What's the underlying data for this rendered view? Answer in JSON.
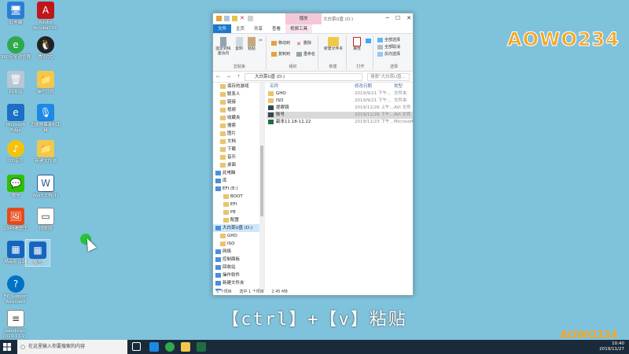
{
  "desktop": {
    "icons": [
      {
        "label": "此电脑"
      },
      {
        "label": "Adobe Acrobat DC"
      },
      {
        "label": "360安全浏览器"
      },
      {
        "label": "腾讯QQ"
      },
      {
        "label": "回收站"
      },
      {
        "label": "操作软件"
      },
      {
        "label": "Microsoft Edge"
      },
      {
        "label": "迅捷屏幕录制工具"
      },
      {
        "label": "QQ音乐"
      },
      {
        "label": "新建文件夹"
      },
      {
        "label": "微信"
      },
      {
        "label": "Word文档(1)"
      },
      {
        "label": "2345看图王"
      },
      {
        "label": "提眼镜"
      },
      {
        "label": "精品影音16"
      },
      {
        "label": "账号"
      },
      {
        "label": "HP Support Assistant"
      },
      {
        "label": "bandicam 2019-11-2..."
      }
    ]
  },
  "logo": {
    "text": "AOWO234"
  },
  "window": {
    "title": "大白菜U盘 (D:)",
    "manage_tab": "播放",
    "tabs": [
      "文件",
      "主页",
      "共享",
      "查看",
      "视频工具"
    ],
    "ribbon": {
      "clipboard": {
        "group": "剪贴板",
        "pin": "固定到快速访问",
        "copy": "复制",
        "paste": "粘贴"
      },
      "organize": {
        "group": "组织",
        "move": "移动到",
        "copy_to": "复制到",
        "delete": "删除",
        "rename": "重命名"
      },
      "new": {
        "group": "新建",
        "new_folder": "新建文件夹"
      },
      "open": {
        "group": "打开",
        "properties": "属性"
      },
      "select": {
        "group": "选择",
        "all": "全部选择",
        "none": "全部取消",
        "invert": "反向选择"
      }
    },
    "address": {
      "nav": "← → ↑",
      "path": "大白菜U盘 (D:)",
      "search": "搜索\"大白菜U盘..."
    },
    "nav_items": [
      {
        "label": "保存的游戏",
        "indent": 0
      },
      {
        "label": "联系人",
        "indent": 0
      },
      {
        "label": "链接",
        "indent": 0
      },
      {
        "label": "视频",
        "indent": 0
      },
      {
        "label": "收藏夹",
        "indent": 0
      },
      {
        "label": "搜索",
        "indent": 0
      },
      {
        "label": "图片",
        "indent": 0
      },
      {
        "label": "文档",
        "indent": 0
      },
      {
        "label": "下载",
        "indent": 0
      },
      {
        "label": "音乐",
        "indent": 0
      },
      {
        "label": "桌面",
        "indent": 0
      },
      {
        "label": "此电脑",
        "indent": -1
      },
      {
        "label": "库",
        "indent": -1
      },
      {
        "label": "EFI (E:)",
        "indent": -1
      },
      {
        "label": "BOOT",
        "indent": 1
      },
      {
        "label": "EFI",
        "indent": 1
      },
      {
        "label": "PE",
        "indent": 1
      },
      {
        "label": "配置",
        "indent": 1
      },
      {
        "label": "大白菜U盘 (D:)",
        "indent": -1,
        "selected": true
      },
      {
        "label": "GHO",
        "indent": 0
      },
      {
        "label": "ISO",
        "indent": 0
      },
      {
        "label": "网络",
        "indent": -1
      },
      {
        "label": "控制面板",
        "indent": -1
      },
      {
        "label": "回收站",
        "indent": -1
      },
      {
        "label": "操作软件",
        "indent": -1
      },
      {
        "label": "新建文件夹",
        "indent": -1
      },
      {
        "label": "...",
        "indent": -1
      }
    ],
    "columns": {
      "name": "名称",
      "date": "修改日期",
      "type": "类型"
    },
    "files": [
      {
        "name": "GHO",
        "date": "2019/9/21 下午...",
        "type": "文件夹",
        "icon": "folder"
      },
      {
        "name": "ISO",
        "date": "2019/9/21 下午...",
        "type": "文件夹",
        "icon": "folder"
      },
      {
        "name": "提眼镜",
        "date": "2019/11/26 上午...",
        "type": "AVI 文件",
        "icon": "video"
      },
      {
        "name": "账号",
        "date": "2019/11/26 下午...",
        "type": "AVI 文件",
        "icon": "video",
        "selected": true
      },
      {
        "name": "副本11.18-11.22",
        "date": "2019/11/23 下午...",
        "type": "Microsoft",
        "icon": "excel"
      }
    ],
    "status": {
      "count": "5 个项目",
      "selected": "选中 1 个项目",
      "size": "2.45 MB"
    }
  },
  "caption": "【ctrl】+【v】粘贴",
  "taskbar": {
    "search_placeholder": "在这里输入你要搜索的内容",
    "time": "10:40",
    "date": "2019/11/27"
  },
  "colors": {
    "desktop": "#7fc2dc",
    "accent": "#1979ca",
    "taskbar": "#1b2a3a"
  }
}
